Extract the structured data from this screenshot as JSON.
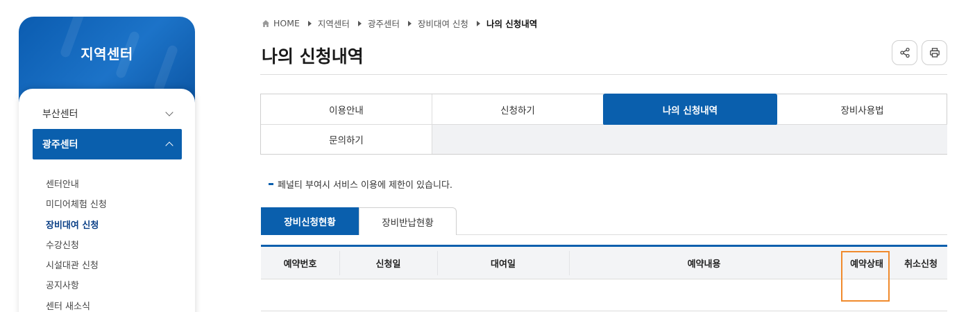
{
  "sidebar": {
    "title": "지역센터",
    "menu": [
      {
        "label": "부산센터",
        "expanded": false
      },
      {
        "label": "광주센터",
        "expanded": true
      }
    ],
    "sub_items": [
      "센터안내",
      "미디어체험 신청",
      "장비대여 신청",
      "수강신청",
      "시설대관 신청",
      "공지사항",
      "센터 새소식"
    ],
    "active_sub_item": "장비대여 신청"
  },
  "breadcrumb": {
    "items": [
      "HOME",
      "지역센터",
      "광주센터",
      "장비대여 신청",
      "나의 신청내역"
    ]
  },
  "page": {
    "title": "나의 신청내역",
    "share_icon": "share-icon",
    "print_icon": "print-icon"
  },
  "tabs": {
    "items": [
      "이용안내",
      "신청하기",
      "나의 신청내역",
      "장비사용법",
      "문의하기"
    ],
    "active": "나의 신청내역"
  },
  "notice": "페널티 부여시 서비스 이용에 제한이 있습니다.",
  "subtabs": {
    "items": [
      "장비신청현황",
      "장비반납현황"
    ],
    "active": "장비신청현황"
  },
  "table": {
    "columns": [
      "예약번호",
      "신청일",
      "대여일",
      "예약내용",
      "예약상태",
      "취소신청"
    ],
    "rows": []
  },
  "colors": {
    "primary": "#0a5fad",
    "highlight": "#f08a2c"
  }
}
